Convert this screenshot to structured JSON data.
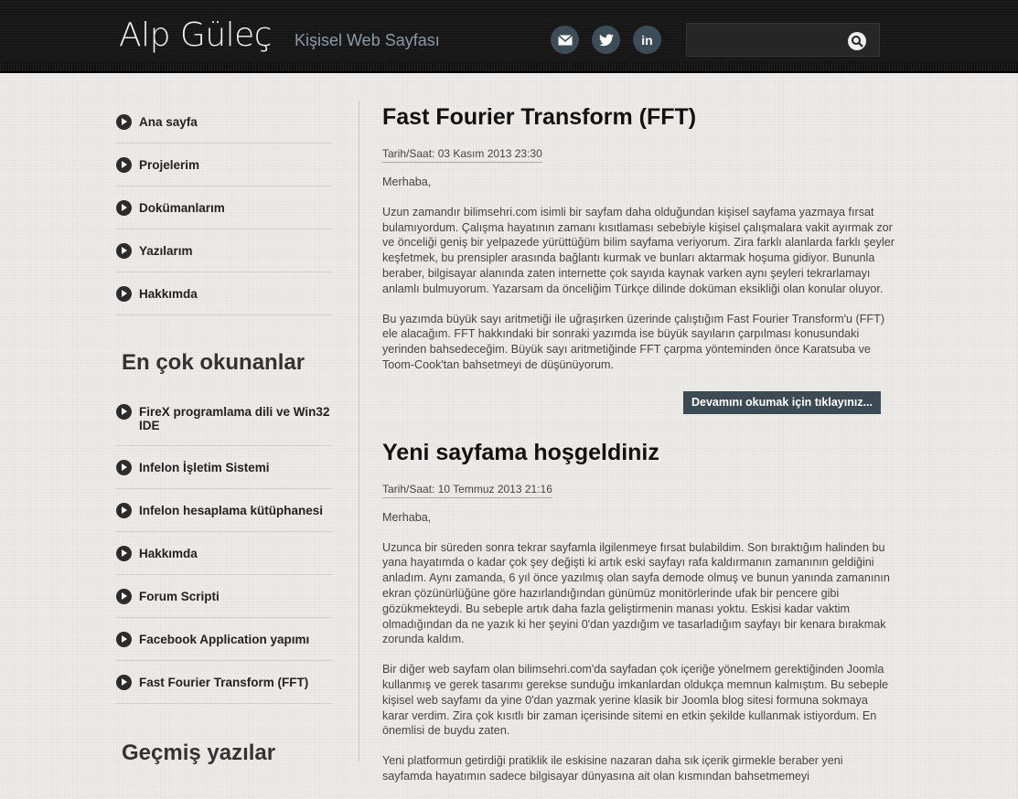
{
  "header": {
    "title": "Alp Güleç",
    "subtitle": "Kişisel Web Sayfası",
    "social": [
      {
        "icon": "mail-icon",
        "glyph": "✉"
      },
      {
        "icon": "twitter-icon",
        "glyph": "🐦"
      },
      {
        "icon": "linkedin-icon",
        "glyph": "in"
      }
    ],
    "search_placeholder": ""
  },
  "sidebar": {
    "nav": [
      "Ana sayfa",
      "Projelerim",
      "Dokümanlarım",
      "Yazılarım",
      "Hakkımda"
    ],
    "popular_heading": "En çok okunanlar",
    "popular": [
      "FireX programlama dili ve Win32 IDE",
      "Infelon İşletim Sistemi",
      "Infelon hesaplama kütüphanesi",
      "Hakkımda",
      "Forum Scripti",
      "Facebook Application yapımı",
      "Fast Fourier Transform (FFT)"
    ],
    "archive_heading": "Geçmiş yazılar"
  },
  "posts": [
    {
      "title": "Fast Fourier Transform (FFT)",
      "date": "Tarih/Saat: 03 Kasım 2013 23:30",
      "paragraphs": [
        "Merhaba,",
        "Uzun zamandır bilimsehri.com isimli bir sayfam daha olduğundan kişisel sayfama yazmaya fırsat bulamıyordum. Çalışma hayatının zamanı kısıtlaması sebebiyle kişisel çalışmalara vakit ayırmak zor ve önceliği geniş bir yelpazede yürüttüğüm bilim sayfama veriyorum. Zira farklı alanlarda farklı şeyler keşfetmek, bu prensipler arasında bağlantı kurmak ve bunları aktarmak hoşuma gidiyor. Bununla beraber, bilgisayar alanında zaten internette çok sayıda kaynak varken aynı şeyleri tekrarlamayı anlamlı bulmuyorum. Yazarsam da önceliğim Türkçe dilinde doküman eksikliği olan konular oluyor.",
        "Bu yazımda büyük sayı aritmetiği ile uğraşırken üzerinde çalıştığım Fast Fourier Transform'u (FFT) ele alacağım. FFT hakkındaki bir sonraki yazımda ise büyük sayıların çarpılması konusundaki yerinden bahsedeceğim. Büyük sayı aritmetiğinde FFT çarpma yönteminden önce Karatsuba ve Toom-Cook'tan bahsetmeyi de düşünüyorum."
      ],
      "readmore": "Devamını okumak için tıklayınız..."
    },
    {
      "title": "Yeni sayfama hoşgeldiniz",
      "date": "Tarih/Saat: 10 Temmuz 2013 21:16",
      "paragraphs": [
        "Merhaba,",
        "Uzunca bir süreden sonra tekrar sayfamla ilgilenmeye fırsat bulabildim. Son bıraktığım halinden bu yana hayatımda o kadar çok şey değişti ki artık eski sayfayı rafa kaldırmanın zamanının geldiğini anladım. Aynı zamanda, 6 yıl önce yazılmış olan sayfa demode olmuş ve bunun yanında zamanının ekran çözünürlüğüne göre hazırlandığından günümüz monitörlerinde ufak bir pencere gibi gözükmekteydi. Bu sebeple artık daha fazla geliştirmenin manası yoktu. Eskisi kadar vaktim olmadığından da ne yazık ki her şeyini 0'dan yazdığım ve tasarladığım sayfayı bir kenara bırakmak zorunda kaldım.",
        "Bir diğer web sayfam olan bilimsehri.com'da sayfadan çok içeriğe yönelmem gerektiğinden Joomla kullanmış ve gerek tasarımı gerekse sunduğu imkanlardan oldukça memnun kalmıştım. Bu sebeple kişisel web sayfamı da yine 0'dan yazmak yerine klasik bir Joomla blog sitesi formuna sokmaya karar verdim. Zira çok kısıtlı bir zaman içerisinde sitemi en etkin şekilde kullanmak istiyordum. En önemlisi de buydu zaten.",
        "Yeni platformun getirdiği pratiklik ile eskisine nazaran daha sık içerik girmekle beraber yeni sayfamda hayatımın sadece bilgisayar dünyasına ait olan kısmından bahsetmemeyi"
      ]
    }
  ]
}
